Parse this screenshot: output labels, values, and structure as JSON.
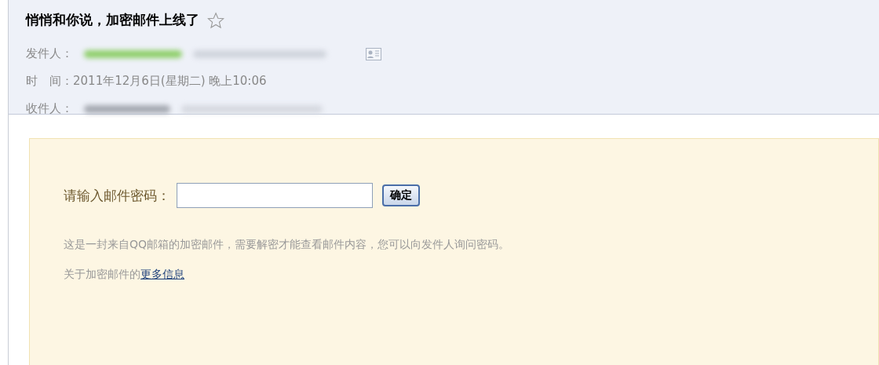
{
  "email": {
    "subject": "悄悄和你说，加密邮件上线了",
    "starred": false,
    "fields": [
      {
        "kind": "sender",
        "label": "发件人："
      },
      {
        "kind": "time",
        "label": "时　间：",
        "value": "2011年12月6日(星期二) 晚上10:06"
      },
      {
        "kind": "recipient",
        "label": "收件人："
      }
    ]
  },
  "password_panel": {
    "label": "请输入邮件密码：",
    "button": "确定",
    "notice": "这是一封来自QQ邮箱的加密邮件，需要解密才能查看邮件内容，您可以向发件人询问密码。",
    "more_prefix": "关于加密邮件的",
    "more_link": "更多信息"
  }
}
